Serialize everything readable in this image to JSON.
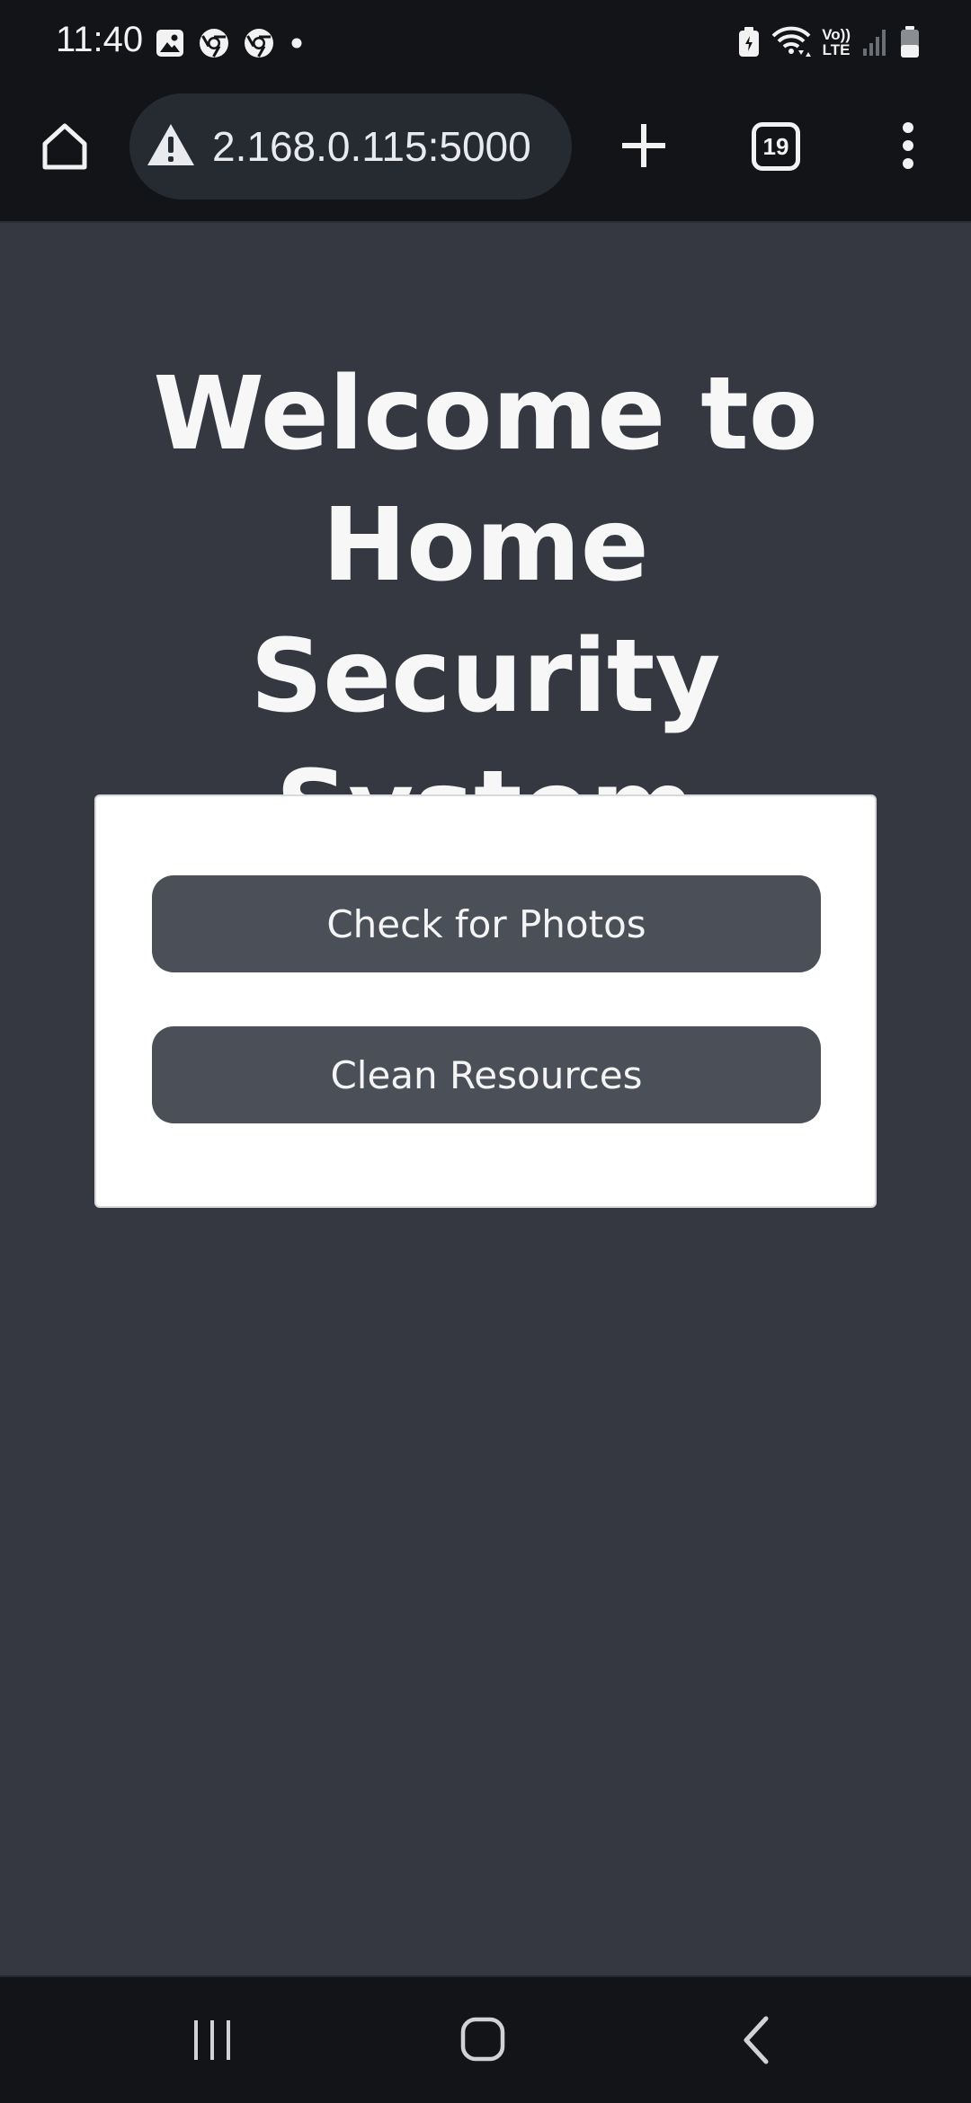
{
  "status_bar": {
    "time": "11:40",
    "left_icons": [
      "gallery-icon",
      "chrome-icon",
      "chrome-icon",
      "dot-icon"
    ],
    "right_icons": [
      "battery-saver-icon",
      "wifi-icon",
      "volte-icon",
      "signal-icon",
      "battery-icon"
    ],
    "volte_top": "Vo))",
    "volte_bottom": "LTE"
  },
  "browser": {
    "url": "2.168.0.115:5000",
    "tab_count": "19",
    "icons": [
      "home-icon",
      "warning-icon",
      "plus-icon",
      "tabs-icon",
      "more-vert-icon"
    ]
  },
  "main": {
    "title": "Welcome to Home Security System",
    "buttons": [
      {
        "label": "Check for Photos"
      },
      {
        "label": "Clean Resources"
      }
    ]
  },
  "nav_bar": {
    "icons": [
      "recents-icon",
      "home-nav-icon",
      "back-icon"
    ]
  },
  "colors": {
    "background": "#353840",
    "bars": "#121418",
    "card": "#ffffff",
    "button": "#4a4f58",
    "text_light": "#f7f7f8"
  }
}
